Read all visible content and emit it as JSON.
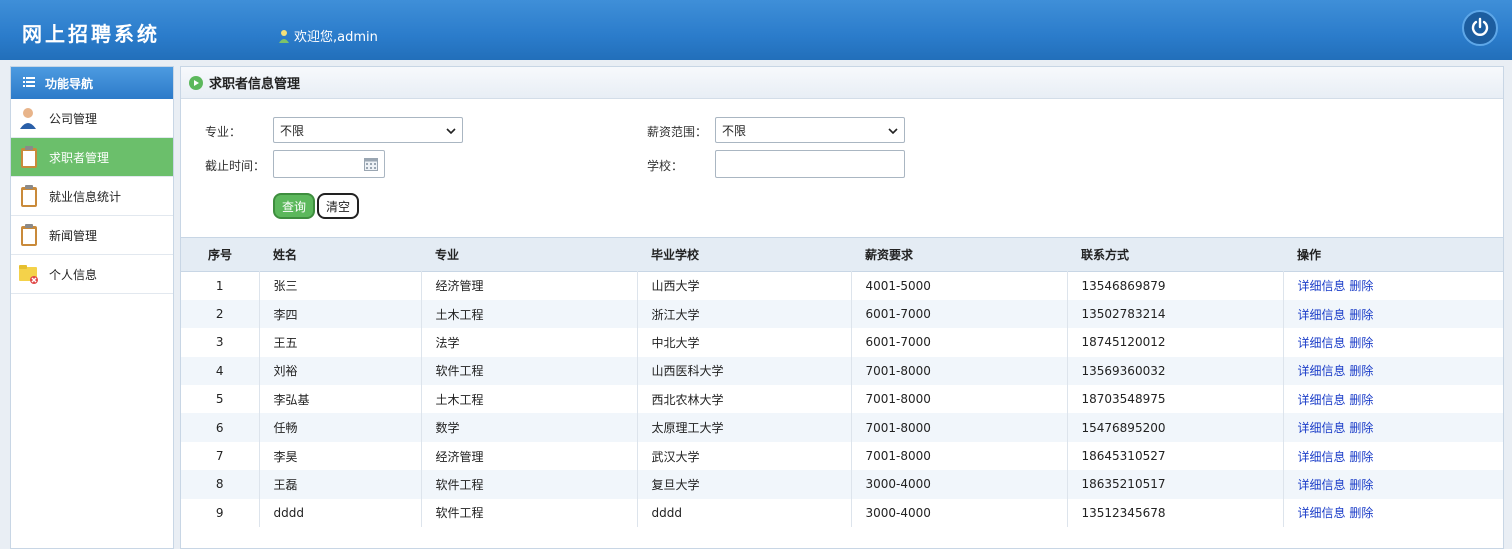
{
  "header": {
    "brand": "网上招聘系统",
    "welcome": "欢迎您,admin"
  },
  "sidebar": {
    "title": "功能导航",
    "items": [
      {
        "label": "公司管理",
        "icon": "user-icon"
      },
      {
        "label": "求职者管理",
        "icon": "clipboard-icon"
      },
      {
        "label": "就业信息统计",
        "icon": "clipboard-icon"
      },
      {
        "label": "新闻管理",
        "icon": "clipboard-icon"
      },
      {
        "label": "个人信息",
        "icon": "folder-icon"
      }
    ],
    "active_index": 1
  },
  "panel": {
    "title": "求职者信息管理"
  },
  "form": {
    "major_label": "专业：",
    "major_value": "不限",
    "salary_label": "薪资范围：",
    "salary_value": "不限",
    "deadline_label": "截止时间：",
    "deadline_value": "",
    "school_label": "学校：",
    "school_value": "",
    "query_button": "查询",
    "clear_button": "清空"
  },
  "table": {
    "headers": [
      "序号",
      "姓名",
      "专业",
      "毕业学校",
      "薪资要求",
      "联系方式",
      "操作"
    ],
    "detail_link": "详细信息",
    "delete_link": "删除",
    "rows": [
      [
        "1",
        "张三",
        "经济管理",
        "山西大学",
        "4001-5000",
        "13546869879"
      ],
      [
        "2",
        "李四",
        "土木工程",
        "浙江大学",
        "6001-7000",
        "13502783214"
      ],
      [
        "3",
        "王五",
        "法学",
        "中北大学",
        "6001-7000",
        "18745120012"
      ],
      [
        "4",
        "刘裕",
        "软件工程",
        "山西医科大学",
        "7001-8000",
        "13569360032"
      ],
      [
        "5",
        "李弘基",
        "土木工程",
        "西北农林大学",
        "7001-8000",
        "18703548975"
      ],
      [
        "6",
        "任畅",
        "数学",
        "太原理工大学",
        "7001-8000",
        "15476895200"
      ],
      [
        "7",
        "李昊",
        "经济管理",
        "武汉大学",
        "7001-8000",
        "18645310527"
      ],
      [
        "8",
        "王磊",
        "软件工程",
        "复旦大学",
        "3000-4000",
        "18635210517"
      ],
      [
        "9",
        "dddd",
        "软件工程",
        "dddd",
        "3000-4000",
        "13512345678"
      ]
    ]
  }
}
